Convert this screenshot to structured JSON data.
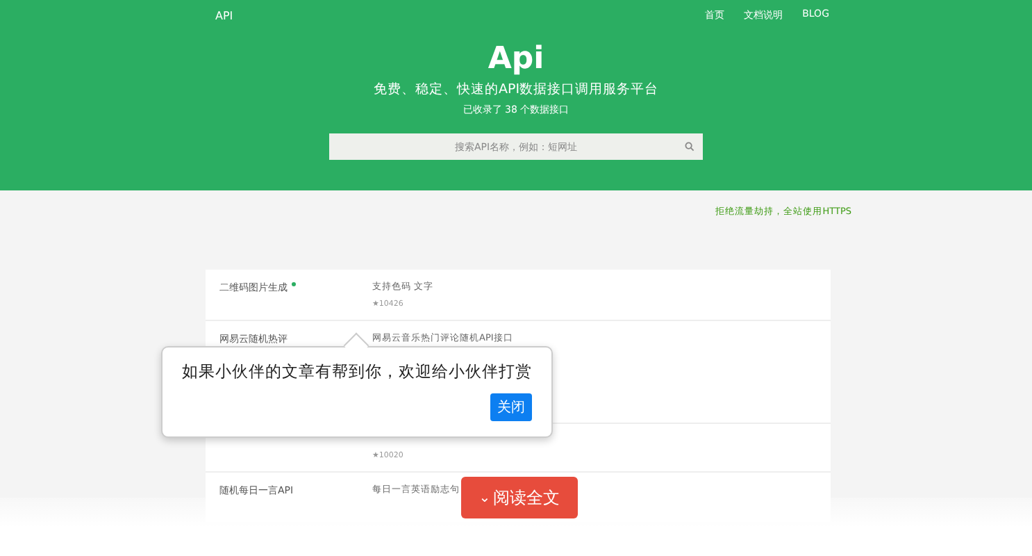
{
  "header": {
    "brand": "API",
    "nav": [
      {
        "label": "首页"
      },
      {
        "label": "文档说明"
      },
      {
        "label": "BLOG"
      }
    ],
    "title": "Api",
    "tagline": "免费、稳定、快速的API数据接口调用服务平台",
    "count_text": "已收录了 38 个数据接口"
  },
  "search": {
    "placeholder": "搜索API名称，例如：短网址"
  },
  "notice": "拒绝流量劫持，全站使用HTTPS",
  "apis": [
    {
      "name": "二维码图片生成",
      "new": true,
      "description": "支持色码 文字 ",
      "stat": "★10426"
    },
    {
      "name": "网易云随机热评",
      "new": false,
      "description": "网易云音乐热门评论随机API接口"
    },
    {
      "stat": "★10020"
    },
    {
      "name": "随机每日一言API",
      "new": false,
      "description": "每日一言英语励志句"
    }
  ],
  "popup": {
    "message": "如果小伙伴的文章有帮到你，欢迎给小伙伴打赏",
    "button": "关闭"
  },
  "read_more": {
    "icon": "⌄",
    "label": "阅读全文"
  }
}
